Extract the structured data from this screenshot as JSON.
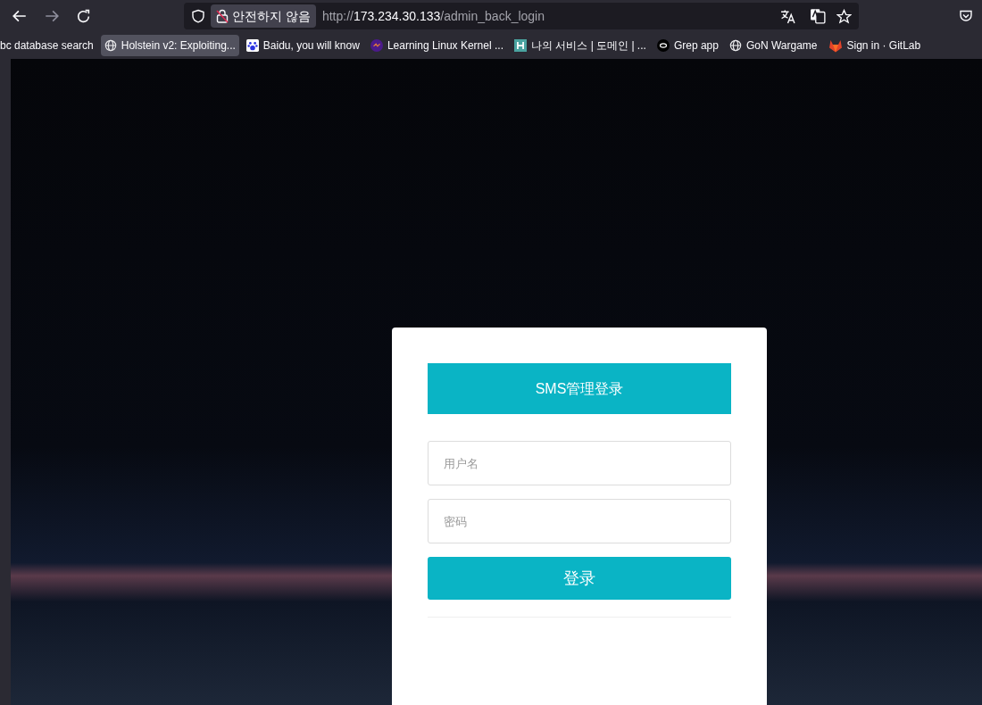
{
  "toolbar": {
    "security_label": "안전하지 않음",
    "url": {
      "scheme": "http://",
      "host": "173.234.30.133",
      "path": "/admin_back_login"
    }
  },
  "bookmarks": [
    {
      "label": "bc database search",
      "selected": false
    },
    {
      "label": "Holstein v2: Exploiting...",
      "selected": true
    },
    {
      "label": "Baidu, you will know",
      "selected": false
    },
    {
      "label": "Learning Linux Kernel ...",
      "selected": false
    },
    {
      "label": "나의 서비스 | 도메인 | ...",
      "selected": false
    },
    {
      "label": "Grep app",
      "selected": false
    },
    {
      "label": "GoN Wargame",
      "selected": false
    },
    {
      "label": "Sign in · GitLab",
      "selected": false
    }
  ],
  "login": {
    "title": "SMS管理登录",
    "username": {
      "placeholder": "用户名"
    },
    "password": {
      "placeholder": "密码"
    },
    "submit": "登录"
  }
}
